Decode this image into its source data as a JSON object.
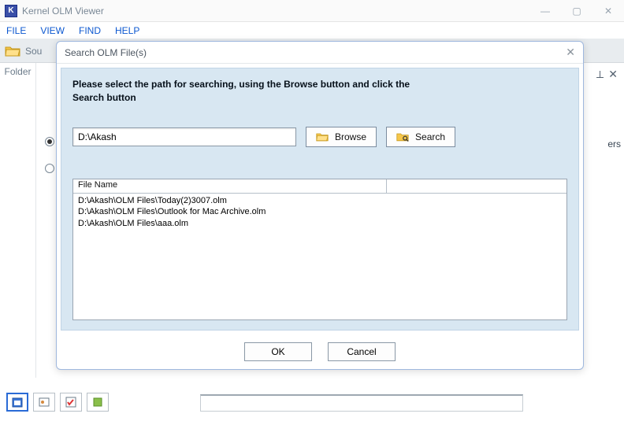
{
  "app": {
    "title": "Kernel OLM Viewer",
    "icon_letter": "K"
  },
  "menubar": [
    "FILE",
    "VIEW",
    "FIND",
    "HELP"
  ],
  "toolbar": {
    "source_label": "Sou"
  },
  "left_pane": {
    "label": "Folder"
  },
  "right": {
    "text_fragment": "ers"
  },
  "dialog": {
    "title": "Search OLM File(s)",
    "instruction": "Please select the path for searching, using the Browse button and click the Search button",
    "path_value": "D:\\Akash",
    "browse_label": "Browse",
    "search_label": "Search",
    "columns": {
      "file_name": "File Name"
    },
    "results": [
      "D:\\Akash\\OLM Files\\Today(2)3007.olm",
      "D:\\Akash\\OLM Files\\Outlook for Mac Archive.olm",
      "D:\\Akash\\OLM Files\\aaa.olm"
    ],
    "ok_label": "OK",
    "cancel_label": "Cancel"
  }
}
